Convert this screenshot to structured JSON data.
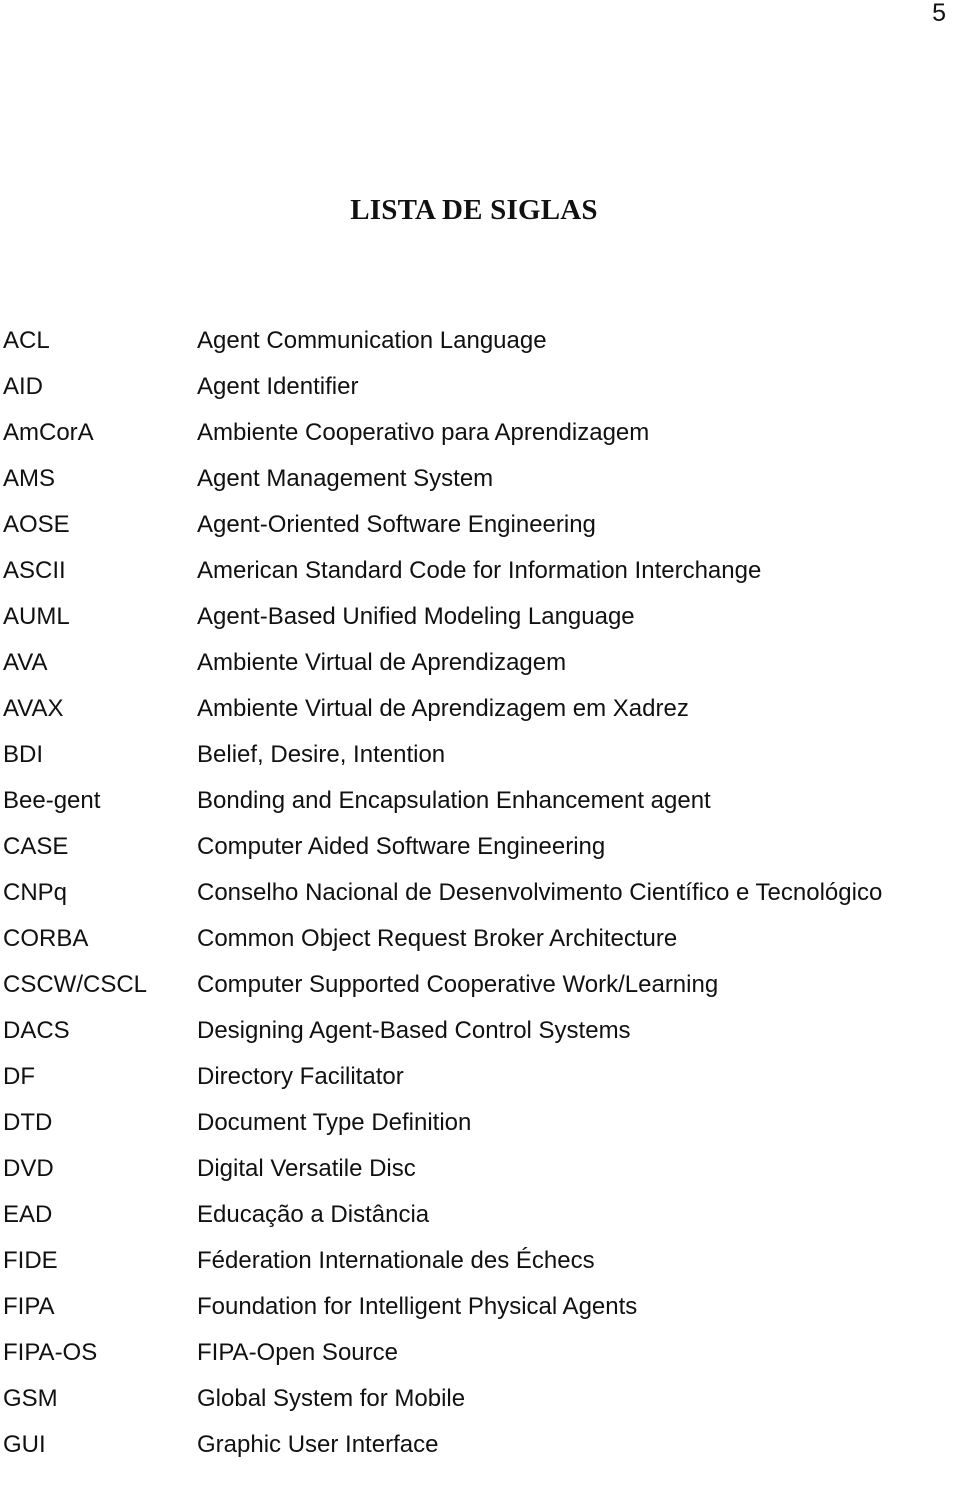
{
  "page_number": "5",
  "title": "LISTA DE SIGLAS",
  "entries": [
    {
      "abbr": "ACL",
      "definition": "Agent Communication Language"
    },
    {
      "abbr": "AID",
      "definition": "Agent Identifier"
    },
    {
      "abbr": "AmCorA",
      "definition": "Ambiente Cooperativo para Aprendizagem"
    },
    {
      "abbr": "AMS",
      "definition": "Agent Management System"
    },
    {
      "abbr": "AOSE",
      "definition": "Agent-Oriented Software Engineering"
    },
    {
      "abbr": "ASCII",
      "definition": "American Standard Code for Information Interchange"
    },
    {
      "abbr": "AUML",
      "definition": "Agent-Based Unified Modeling Language"
    },
    {
      "abbr": "AVA",
      "definition": "Ambiente Virtual de Aprendizagem"
    },
    {
      "abbr": "AVAX",
      "definition": "Ambiente Virtual de Aprendizagem em Xadrez"
    },
    {
      "abbr": "BDI",
      "definition": "Belief, Desire, Intention"
    },
    {
      "abbr": "Bee-gent",
      "definition": "Bonding and Encapsulation Enhancement agent"
    },
    {
      "abbr": "CASE",
      "definition": "Computer Aided Software Engineering"
    },
    {
      "abbr": "CNPq",
      "definition": "Conselho Nacional de Desenvolvimento Científico e Tecnológico"
    },
    {
      "abbr": "CORBA",
      "definition": "Common Object Request Broker Architecture"
    },
    {
      "abbr": "CSCW/CSCL",
      "definition": "Computer Supported Cooperative Work/Learning"
    },
    {
      "abbr": "DACS",
      "definition": "Designing Agent-Based Control Systems"
    },
    {
      "abbr": "DF",
      "definition": "Directory Facilitator"
    },
    {
      "abbr": "DTD",
      "definition": "Document Type Definition"
    },
    {
      "abbr": "DVD",
      "definition": "Digital Versatile Disc"
    },
    {
      "abbr": "EAD",
      "definition": "Educação a Distância"
    },
    {
      "abbr": "FIDE",
      "definition": "Féderation Internationale des Échecs"
    },
    {
      "abbr": "FIPA",
      "definition": "Foundation for Intelligent Physical Agents"
    },
    {
      "abbr": "FIPA-OS",
      "definition": "FIPA-Open Source"
    },
    {
      "abbr": "GSM",
      "definition": "Global System for Mobile"
    },
    {
      "abbr": "GUI",
      "definition": "Graphic User Interface"
    }
  ]
}
